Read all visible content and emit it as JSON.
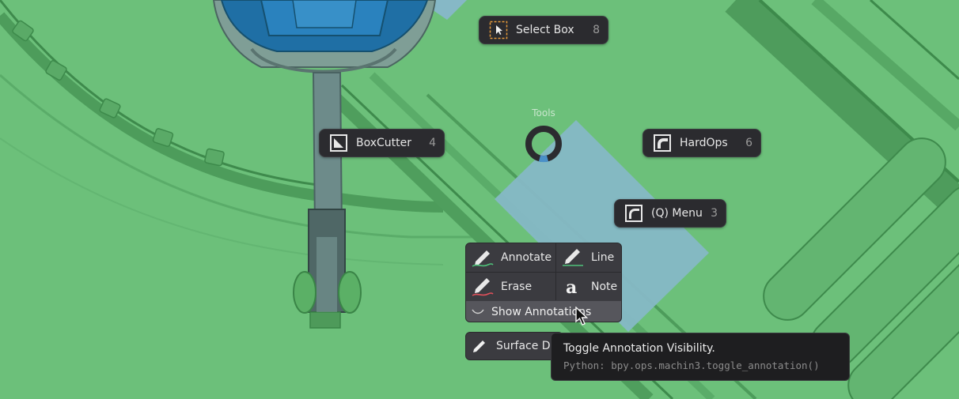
{
  "pie_menu": {
    "title": "Tools",
    "items": [
      {
        "label": "Select Box",
        "shortcut": "8",
        "icon": "select-box-icon"
      },
      {
        "label": "BoxCutter",
        "shortcut": "4",
        "icon": "boxcutter-icon"
      },
      {
        "label": "HardOps",
        "shortcut": "6",
        "icon": "hardops-icon"
      },
      {
        "label": "(Q) Menu",
        "shortcut": "3",
        "icon": "q-menu-icon"
      }
    ]
  },
  "annotation_panel": {
    "annotate_label": "Annotate",
    "line_label": "Line",
    "erase_label": "Erase",
    "note_label": "Note",
    "show_label": "Show Annotations",
    "surface_draw_label": "Surface Draw"
  },
  "tooltip": {
    "title": "Toggle Annotation Visibility.",
    "python": "Python: bpy.ops.machin3.toggle_annotation()"
  },
  "colors": {
    "viewport_bg": "#6cc07a",
    "model_blue": "#1f6fa5",
    "selection_face": "#86b8c6",
    "panel_bg": "#2b2b2f",
    "accent_blue": "#4a90c8"
  }
}
